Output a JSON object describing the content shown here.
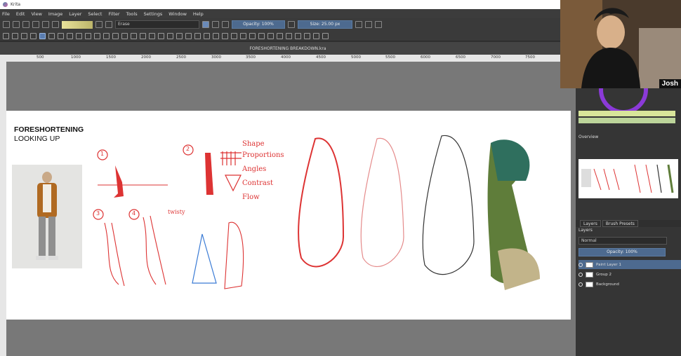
{
  "app": {
    "title": "Krita"
  },
  "menu": [
    "File",
    "Edit",
    "View",
    "Image",
    "Layer",
    "Select",
    "Filter",
    "Tools",
    "Settings",
    "Window",
    "Help"
  ],
  "toolbar": {
    "brush_name": "Erase",
    "opacity": "Opacity: 100%",
    "size": "Size: 25.00 px"
  },
  "document": {
    "tab_title": "FORESHORTENING BREAKDOWN.kra"
  },
  "ruler": {
    "ticks": [
      "500",
      "1000",
      "1500",
      "2000",
      "2500",
      "3000",
      "3500",
      "4000",
      "4500",
      "5000",
      "5500",
      "6000",
      "6500",
      "7000",
      "7500"
    ]
  },
  "canvas": {
    "title": "FORESHORTENING",
    "subtitle": "LOOKING UP",
    "notes": [
      "Shape",
      "Proportions",
      "Angles",
      "Contrast",
      "Flow"
    ],
    "numbers": [
      "1",
      "2",
      "3",
      "4"
    ],
    "twisting": "twisty"
  },
  "webcam": {
    "name": "Josh"
  },
  "dock": {
    "overview_label": "Overview",
    "tabs": [
      "Layers",
      "Brush Presets"
    ],
    "layers_label": "Layers",
    "blend_mode": "Normal",
    "opacity": "Opacity: 100%",
    "layers": [
      {
        "name": "Paint Layer 1",
        "selected": true
      },
      {
        "name": "Group 2",
        "selected": false
      },
      {
        "name": "Background",
        "selected": false
      }
    ]
  }
}
